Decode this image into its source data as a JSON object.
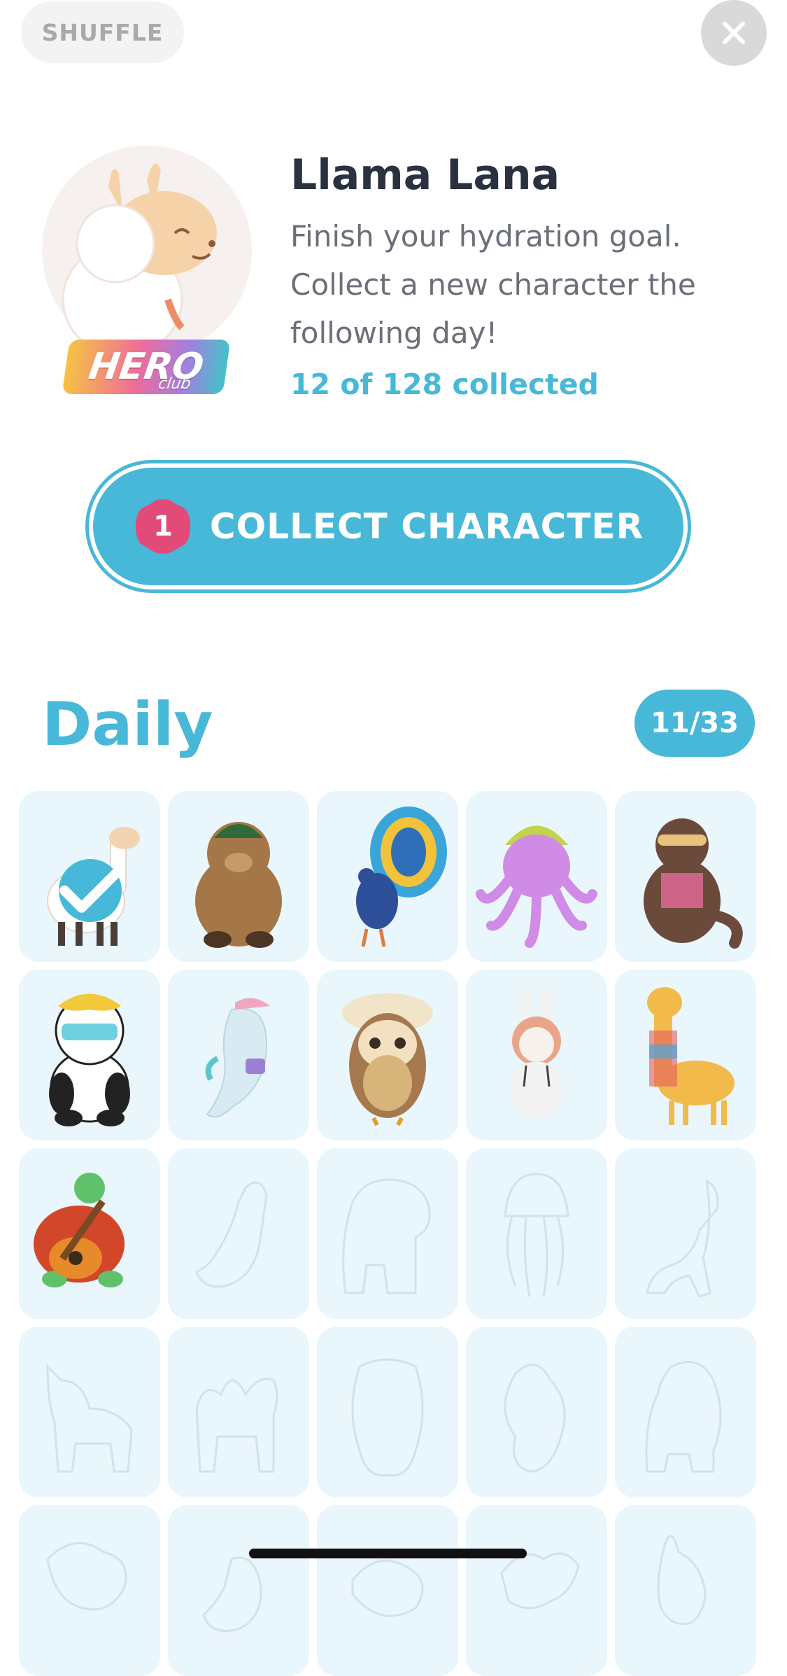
{
  "header": {
    "shuffle_label": "SHUFFLE",
    "close_icon": "close-icon"
  },
  "character": {
    "name": "Llama Lana",
    "description": "Finish your hydration goal. Collect a new character the following day!",
    "collected_text": "12 of 128 collected",
    "badge_main": "HERO",
    "badge_sub": "club"
  },
  "collect_button": {
    "label": "COLLECT CHARACTER",
    "count": "1"
  },
  "section": {
    "title": "Daily",
    "progress": "11/33"
  },
  "colors": {
    "accent": "#48b8d8",
    "badge_pink": "#e24a78",
    "cell_bg": "#e9f6fb"
  },
  "grid": {
    "cells": [
      {
        "icon": "llama-character-icon",
        "state": "selected"
      },
      {
        "icon": "bear-character-icon",
        "state": "collected"
      },
      {
        "icon": "peacock-character-icon",
        "state": "collected"
      },
      {
        "icon": "octopus-character-icon",
        "state": "collected"
      },
      {
        "icon": "otter-character-icon",
        "state": "collected"
      },
      {
        "icon": "panda-character-icon",
        "state": "collected"
      },
      {
        "icon": "dolphin-character-icon",
        "state": "collected"
      },
      {
        "icon": "owl-character-icon",
        "state": "collected"
      },
      {
        "icon": "bunny-character-icon",
        "state": "collected"
      },
      {
        "icon": "giraffe-character-icon",
        "state": "collected"
      },
      {
        "icon": "turtle-character-icon",
        "state": "collected"
      },
      {
        "icon": "dinosaur-silhouette-icon",
        "state": "locked"
      },
      {
        "icon": "elephant-silhouette-icon",
        "state": "locked"
      },
      {
        "icon": "jellyfish-silhouette-icon",
        "state": "locked"
      },
      {
        "icon": "horse-silhouette-icon",
        "state": "locked"
      },
      {
        "icon": "goat-silhouette-icon",
        "state": "locked"
      },
      {
        "icon": "camel-silhouette-icon",
        "state": "locked"
      },
      {
        "icon": "hamster-silhouette-icon",
        "state": "locked"
      },
      {
        "icon": "squirrel-silhouette-icon",
        "state": "locked"
      },
      {
        "icon": "bear-silhouette-icon",
        "state": "locked"
      },
      {
        "icon": "bird-silhouette-icon",
        "state": "locked"
      },
      {
        "icon": "seal-silhouette-icon",
        "state": "locked"
      },
      {
        "icon": "fish-silhouette-icon",
        "state": "locked"
      },
      {
        "icon": "dragon-silhouette-icon",
        "state": "locked"
      },
      {
        "icon": "rabbit-silhouette-icon",
        "state": "locked"
      }
    ]
  }
}
